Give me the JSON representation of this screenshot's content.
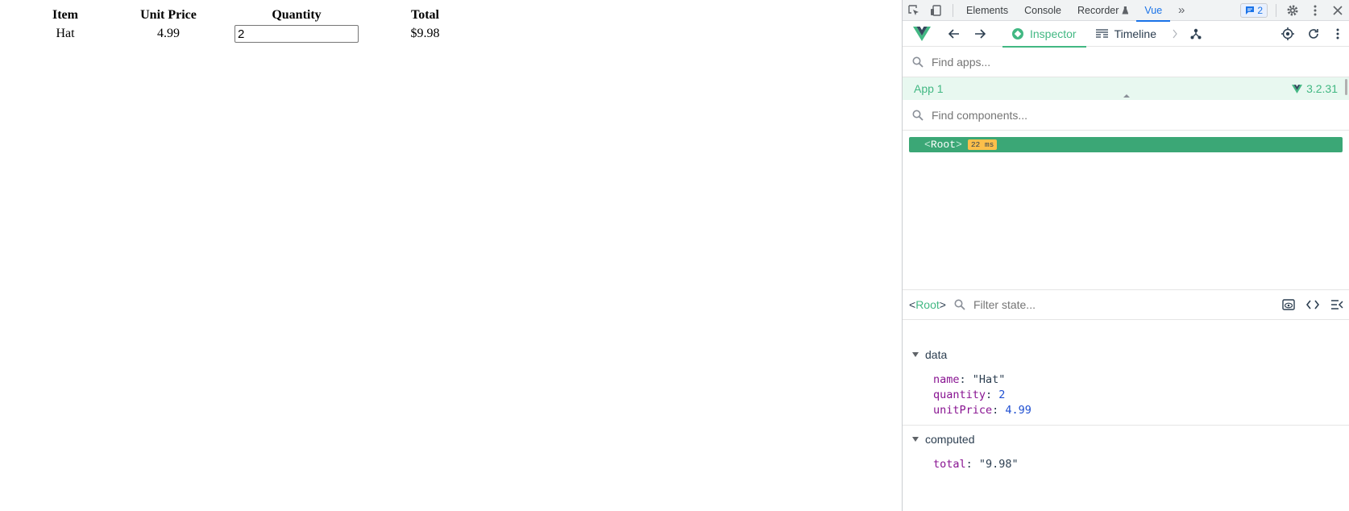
{
  "page": {
    "headers": [
      "Item",
      "Unit Price",
      "Quantity",
      "Total"
    ],
    "row": {
      "item": "Hat",
      "unit_price": "4.99",
      "quantity": "2",
      "total": "$9.98"
    }
  },
  "devtools": {
    "tabs": [
      "Elements",
      "Console",
      "Recorder",
      "Vue"
    ],
    "active_tab": "Vue",
    "issues_count": "2",
    "vue_tabs": {
      "inspector": "Inspector",
      "timeline": "Timeline"
    },
    "find_apps_placeholder": "Find apps...",
    "app": {
      "name": "App 1",
      "version": "3.2.31"
    },
    "find_components_placeholder": "Find components...",
    "root_node": {
      "name": "Root",
      "time": "22 ms"
    },
    "state_panel": {
      "component": "Root",
      "filter_placeholder": "Filter state...",
      "data_label": "data",
      "data": [
        {
          "key": "name",
          "value": "\"Hat\"",
          "kind": "str"
        },
        {
          "key": "quantity",
          "value": "2",
          "kind": "num"
        },
        {
          "key": "unitPrice",
          "value": "4.99",
          "kind": "num"
        }
      ],
      "computed_label": "computed",
      "computed": [
        {
          "key": "total",
          "value": "\"9.98\"",
          "kind": "str"
        }
      ]
    }
  },
  "colors": {
    "vue_green": "#42b883",
    "devtools_blue": "#1a73e8",
    "badge_yellow": "#fcbf4a"
  },
  "icons": [
    "inspect-element-icon",
    "device-toolbar-icon",
    "more-tabs-icon",
    "issues-icon",
    "settings-gear-icon",
    "kebab-menu-icon",
    "close-icon",
    "vue-logo-icon",
    "back-arrow-icon",
    "forward-arrow-icon",
    "compass-icon",
    "timeline-icon",
    "chevron-right-icon",
    "component-tree-icon",
    "target-icon",
    "refresh-icon",
    "search-icon",
    "eye-icon",
    "code-icon",
    "collapse-icon",
    "triangle-down-icon"
  ]
}
